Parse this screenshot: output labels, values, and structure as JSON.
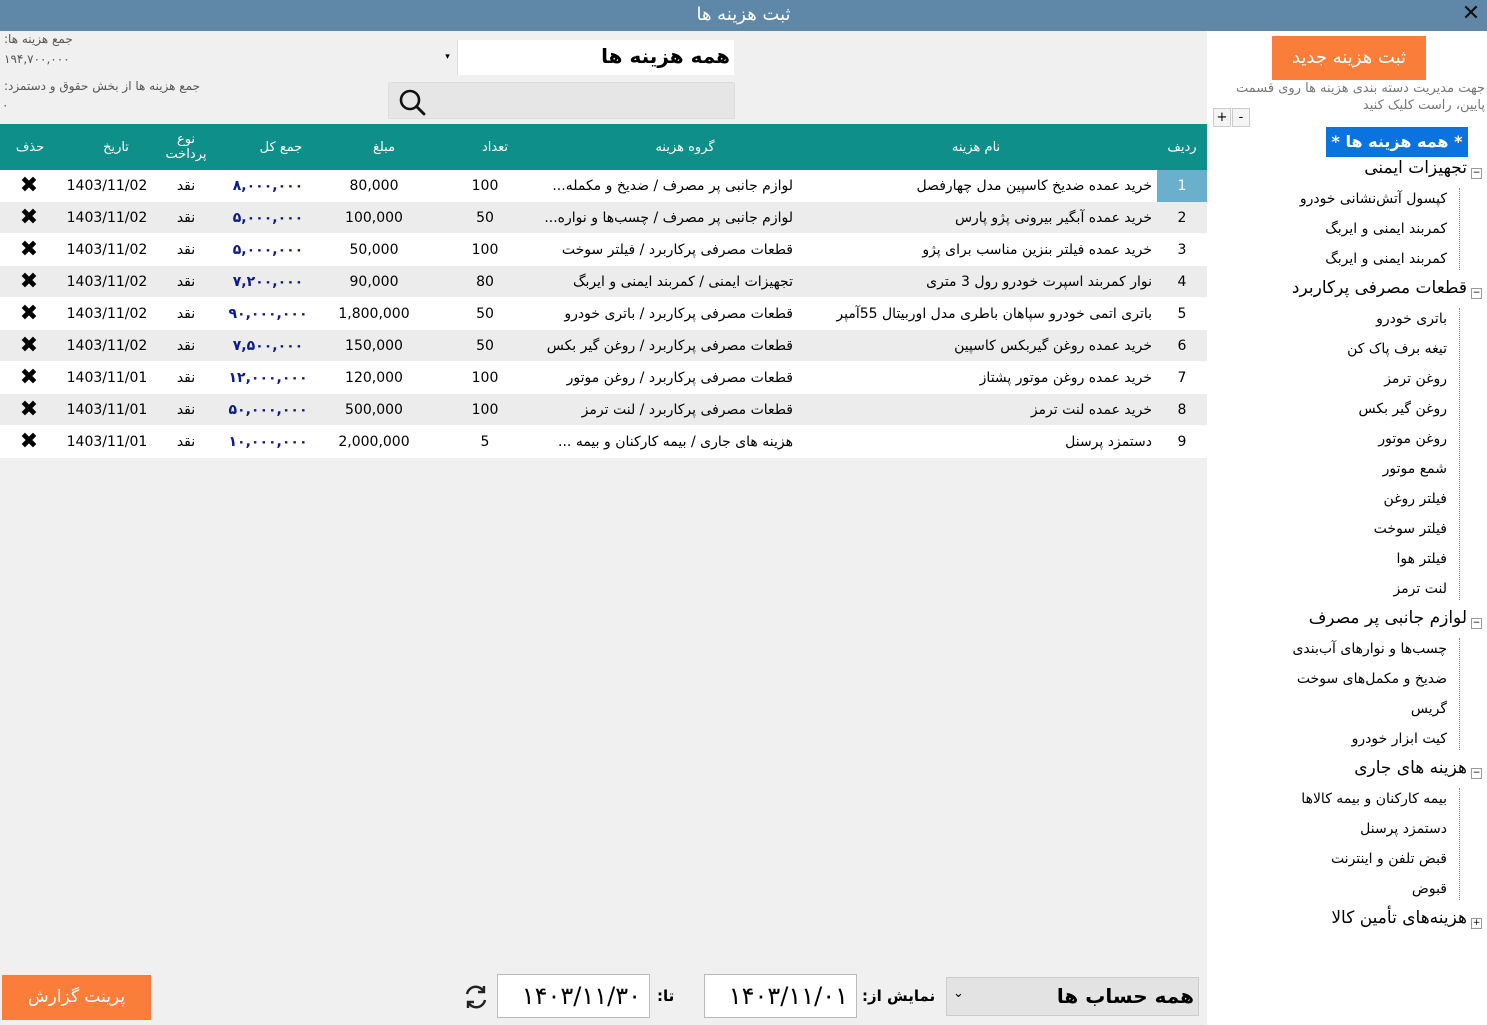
{
  "window": {
    "title": "ثبت هزینه ها",
    "close_label": "✕"
  },
  "summary": {
    "total_label": "جمع هزینه ها:",
    "total_value": "۱۹۴,۷۰۰,۰۰۰",
    "salary_label": "جمع هزینه ها از بخش حقوق و دستمزد:",
    "salary_value": "۰"
  },
  "filter": {
    "group_selected": "همه هزینه ها",
    "search_value": ""
  },
  "grid": {
    "headers": {
      "row": "ردیف",
      "name": "نام هزینه",
      "group": "گروه هزینه",
      "count": "تعداد",
      "amount": "مبلغ",
      "total": "جمع کل",
      "payment": "نوع پرداخت",
      "date": "تاریخ",
      "delete": "حذف"
    },
    "rows": [
      {
        "idx": "1",
        "name": "خرید عمده ضدیخ کاسپین مدل چهارفصل",
        "group": "لوازم جانبی پر مصرف / ضدیخ و مکمله...",
        "count": "100",
        "amount": "80,000",
        "total": "۸,۰۰۰,۰۰۰",
        "payment": "نقد",
        "date": "1403/11/02",
        "del": "✖"
      },
      {
        "idx": "2",
        "name": "خرید عمده آبگیر بیرونی پژو پارس",
        "group": "لوازم جانبی پر مصرف / چسب‌ها و نواره...",
        "count": "50",
        "amount": "100,000",
        "total": "۵,۰۰۰,۰۰۰",
        "payment": "نقد",
        "date": "1403/11/02",
        "del": "✖"
      },
      {
        "idx": "3",
        "name": "خرید عمده فیلتر بنزین مناسب برای پژو",
        "group": "قطعات مصرفی پرکاربرد / فیلتر سوخت",
        "count": "100",
        "amount": "50,000",
        "total": "۵,۰۰۰,۰۰۰",
        "payment": "نقد",
        "date": "1403/11/02",
        "del": "✖"
      },
      {
        "idx": "4",
        "name": "نوار کمربند اسپرت خودرو رول 3 متری",
        "group": "تجهیزات ایمنی / کمربند ایمنی و ایربگ",
        "count": "80",
        "amount": "90,000",
        "total": "۷,۲۰۰,۰۰۰",
        "payment": "نقد",
        "date": "1403/11/02",
        "del": "✖"
      },
      {
        "idx": "5",
        "name": "باتری اتمی خودرو سپاهان باطری مدل اوربیتال 55آمپر",
        "group": "قطعات مصرفی پرکاربرد / باتری خودرو",
        "count": "50",
        "amount": "1,800,000",
        "total": "۹۰,۰۰۰,۰۰۰",
        "payment": "نقد",
        "date": "1403/11/02",
        "del": "✖"
      },
      {
        "idx": "6",
        "name": "خرید عمده روغن گیربکس کاسپین",
        "group": "قطعات مصرفی پرکاربرد / روغن گیر بکس",
        "count": "50",
        "amount": "150,000",
        "total": "۷,۵۰۰,۰۰۰",
        "payment": "نقد",
        "date": "1403/11/02",
        "del": "✖"
      },
      {
        "idx": "7",
        "name": "خرید عمده روغن موتور پشتاز",
        "group": "قطعات مصرفی پرکاربرد / روغن موتور",
        "count": "100",
        "amount": "120,000",
        "total": "۱۲,۰۰۰,۰۰۰",
        "payment": "نقد",
        "date": "1403/11/01",
        "del": "✖"
      },
      {
        "idx": "8",
        "name": "خرید عمده لنت ترمز",
        "group": "قطعات مصرفی پرکاربرد / لنت ترمز",
        "count": "100",
        "amount": "500,000",
        "total": "۵۰,۰۰۰,۰۰۰",
        "payment": "نقد",
        "date": "1403/11/01",
        "del": "✖"
      },
      {
        "idx": "9",
        "name": "دستمزد پرسنل",
        "group": "هزینه های جاری / بیمه کارکنان و بیمه ...",
        "count": "5",
        "amount": "2,000,000",
        "total": "۱۰,۰۰۰,۰۰۰",
        "payment": "نقد",
        "date": "1403/11/01",
        "del": "✖"
      }
    ]
  },
  "sidebar": {
    "new_button": "ثبت هزینه جدید",
    "hint": "جهت مدیریت دسته بندی هزینه ها روی قسمت پایین، راست کلیک کنید",
    "plus_label": "+",
    "minus_label": "-",
    "tree_root": "* همه هزینه ها *",
    "groups": [
      {
        "label": "تجهیزات ایمنی",
        "toggle": "−",
        "items": [
          "کپسول آتش‌نشانی خودرو",
          "کمربند ایمنی و ایربگ",
          "کمربند ایمنی و ایربگ"
        ]
      },
      {
        "label": "قطعات مصرفی پرکاربرد",
        "toggle": "−",
        "items": [
          "باتری خودرو",
          "تیغه برف پاک کن",
          "روغن ترمز",
          "روغن گیر بکس",
          "روغن موتور",
          "شمع موتور",
          "فیلتر روغن",
          "فیلتر سوخت",
          "فیلتر هوا",
          "لنت ترمز"
        ]
      },
      {
        "label": "لوازم جانبی پر مصرف",
        "toggle": "−",
        "items": [
          "چسب‌ها و نوارهای آب‌بندی",
          "ضدیخ و مکمل‌های سوخت",
          "گریس",
          "کیت ابزار خودرو"
        ]
      },
      {
        "label": "هزینه های جاری",
        "toggle": "−",
        "items": [
          "بیمه کارکنان و بیمه کالاها",
          "دستمزد پرسنل",
          "قبض تلفن و اینترنت",
          "قبوض"
        ]
      },
      {
        "label": "هزینه‌های تأمین کالا",
        "toggle": "+",
        "items": []
      }
    ]
  },
  "footer": {
    "account_selected": "همه حساب ها",
    "from_label": "نمایش از:",
    "from_date": "۱۴۰۳/۱۱/۰۱",
    "to_label": "تا:",
    "to_date": "۱۴۰۳/۱۱/۳۰",
    "print_button": "پرینت گزارش"
  }
}
